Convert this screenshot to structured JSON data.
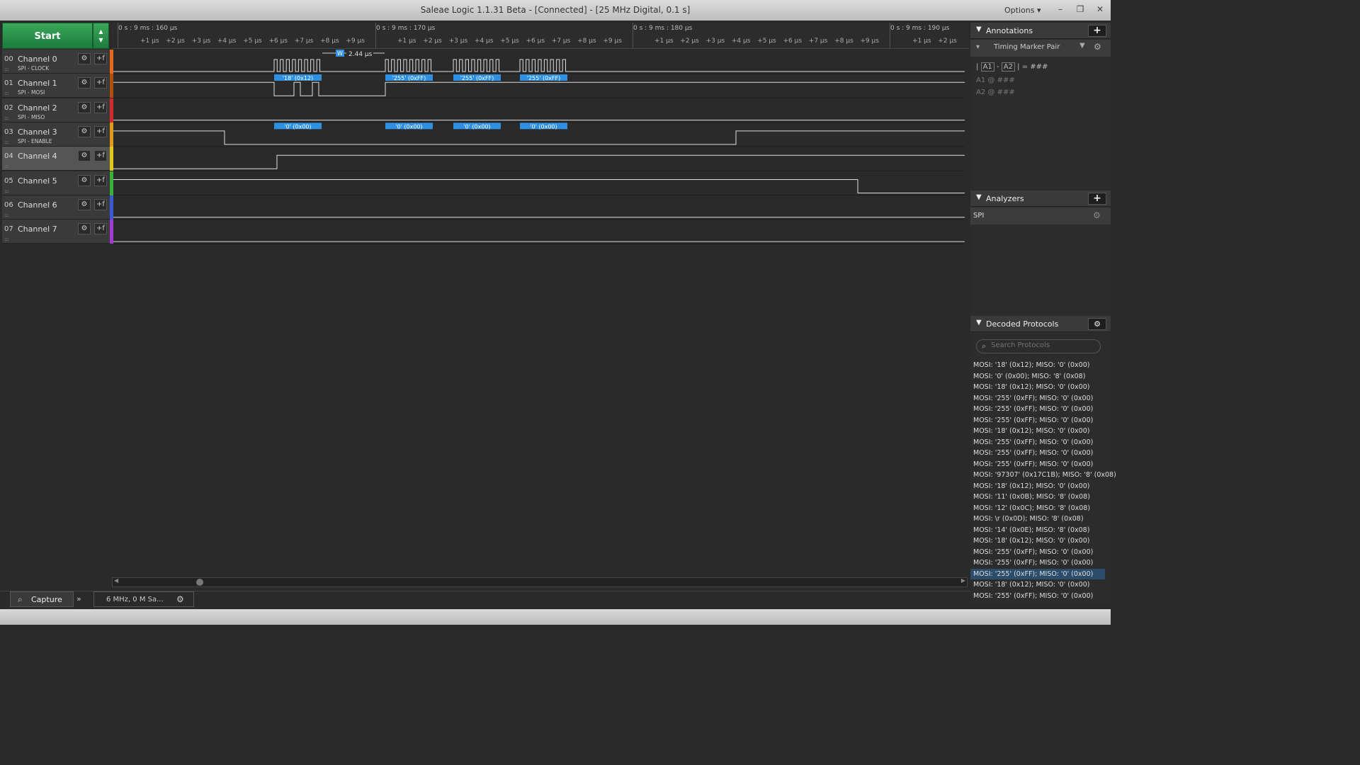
{
  "window": {
    "title": "Saleae Logic 1.1.31 Beta - [Connected] - [25 MHz Digital, 0.1 s]",
    "options_label": "Options ▾",
    "minimize_glyph": "–",
    "restore_glyph": "❐",
    "close_glyph": "✕"
  },
  "controls": {
    "start_label": "Start",
    "up_glyph": "▲",
    "down_glyph": "▼"
  },
  "timeline": {
    "major_labels": [
      "0 s : 9 ms : 160 µs",
      "0 s : 9 ms : 170 µs",
      "0 s : 9 ms : 180 µs",
      "0 s : 9 ms : 190 µs"
    ],
    "minor_ticks_a": [
      "+1 µs",
      "+2 µs",
      "+3 µs",
      "+4 µs",
      "+5 µs",
      "+6 µs",
      "+7 µs",
      "+8 µs",
      "+9 µs"
    ],
    "minor_ticks_b": [
      "+1 µs",
      "+2 µs"
    ],
    "width_measure": "2.44 µs",
    "width_badge": "W"
  },
  "channels": [
    {
      "num": "00",
      "name": "Channel 0",
      "sub": "SPI - CLOCK",
      "color": "#e06a1a"
    },
    {
      "num": "01",
      "name": "Channel 1",
      "sub": "SPI - MOSI",
      "color": "#b0500f"
    },
    {
      "num": "02",
      "name": "Channel 2",
      "sub": "SPI - MISO",
      "color": "#d42a2a"
    },
    {
      "num": "03",
      "name": "Channel 3",
      "sub": "SPI - ENABLE",
      "color": "#e09a1a"
    },
    {
      "num": "04",
      "name": "Channel 4",
      "sub": "",
      "color": "#e0c81a"
    },
    {
      "num": "05",
      "name": "Channel 5",
      "sub": "",
      "color": "#3ab03a"
    },
    {
      "num": "06",
      "name": "Channel 6",
      "sub": "",
      "color": "#3a5ad4"
    },
    {
      "num": "07",
      "name": "Channel 7",
      "sub": "",
      "color": "#a23ad4"
    }
  ],
  "channel_buttons": {
    "settings_glyph": "⚙",
    "trigger_glyph": "+f"
  },
  "decodes": {
    "mosi": [
      "'18' (0x12)",
      "'255' (0xFF)",
      "'255' (0xFF)",
      "'255' (0xFF)"
    ],
    "miso": [
      "'0' (0x00)",
      "'0' (0x00)",
      "'0' (0x00)",
      "'0' (0x00)"
    ]
  },
  "annotations": {
    "header": "Annotations",
    "marker_type": "Timing Marker Pair",
    "a1": "A1",
    "a2": "A2",
    "dash": "-",
    "pipe": "|",
    "eq": "= ###",
    "at": "@",
    "hash": "###"
  },
  "analyzers": {
    "header": "Analyzers",
    "items": [
      "SPI"
    ]
  },
  "decoded_protocols": {
    "header": "Decoded Protocols",
    "search_placeholder": "Search Protocols",
    "items": [
      "MOSI: '18' (0x12);  MISO: '0' (0x00)",
      "MOSI: '0' (0x00);  MISO: '8' (0x08)",
      "MOSI: '18' (0x12);  MISO: '0' (0x00)",
      "MOSI: '255' (0xFF);  MISO: '0' (0x00)",
      "MOSI: '255' (0xFF);  MISO: '0' (0x00)",
      "MOSI: '255' (0xFF);  MISO: '0' (0x00)",
      "MOSI: '18' (0x12);  MISO: '0' (0x00)",
      "MOSI: '255' (0xFF);  MISO: '0' (0x00)",
      "MOSI: '255' (0xFF);  MISO: '0' (0x00)",
      "MOSI: '255' (0xFF);  MISO: '0' (0x00)",
      "MOSI: '97307' (0x17C1B);  MISO: '8' (0x08)",
      "MOSI: '18' (0x12);  MISO: '0' (0x00)",
      "MOSI: '11' (0x0B);  MISO: '8' (0x08)",
      "MOSI: '12' (0x0C);  MISO: '8' (0x08)",
      "MOSI: \\r (0x0D);  MISO: '8' (0x08)",
      "MOSI: '14' (0x0E);  MISO: '8' (0x08)",
      "MOSI: '18' (0x12);  MISO: '0' (0x00)",
      "MOSI: '255' (0xFF);  MISO: '0' (0x00)",
      "MOSI: '255' (0xFF);  MISO: '0' (0x00)",
      "MOSI: '255' (0xFF);  MISO: '0' (0x00)",
      "MOSI: '18' (0x12);  MISO: '0' (0x00)",
      "MOSI: '255' (0xFF);  MISO: '0' (0x00)"
    ],
    "selected_index": 19
  },
  "bottom": {
    "capture_label": "Capture",
    "sample_info": "6 MHz, 0 M Sa...",
    "expand_glyph": "»",
    "search_glyph": "⌕"
  }
}
